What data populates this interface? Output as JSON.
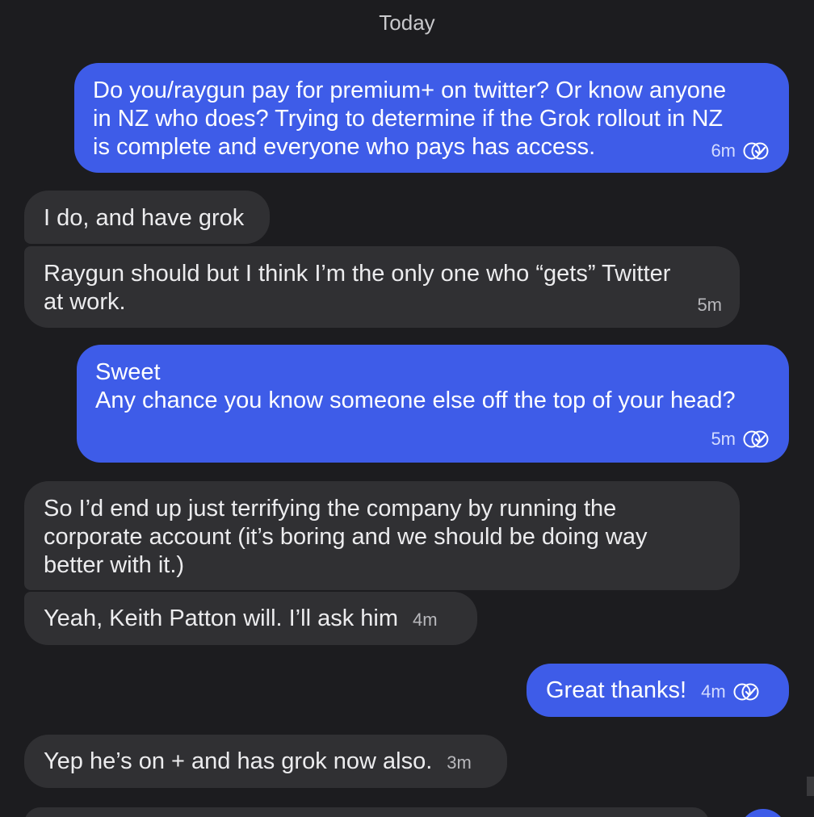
{
  "date_separator": "Today",
  "messages": [
    {
      "text": "Do you/raygun pay for premium+ on twitter? Or know anyone\nin NZ who does? Trying to determine if the Grok rollout in NZ\nis complete and everyone who pays has access.",
      "time": "6m"
    },
    {
      "text": "I do, and have grok"
    },
    {
      "text": "Raygun should but I think I’m the only one who “gets” Twitter\nat work.",
      "time": "5m"
    },
    {
      "text": "Sweet\nAny chance you know someone else off the top of your head?",
      "time": "5m"
    },
    {
      "text": "So I’d end up just terrifying the company by running the\ncorporate account (it’s boring and we should be doing way\nbetter with it.)"
    },
    {
      "text": "Yeah, Keith Patton will. I’ll ask him",
      "time": "4m"
    },
    {
      "text": "Great thanks!",
      "time": "4m"
    },
    {
      "text": "Yep he’s on + and has grok now also.",
      "time": "3m"
    }
  ],
  "icons": {
    "read_receipt": "double-check-circle-icon"
  },
  "colors": {
    "background": "#1c1c1f",
    "sent_bubble": "#3e5ce8",
    "received_bubble": "#303033"
  }
}
